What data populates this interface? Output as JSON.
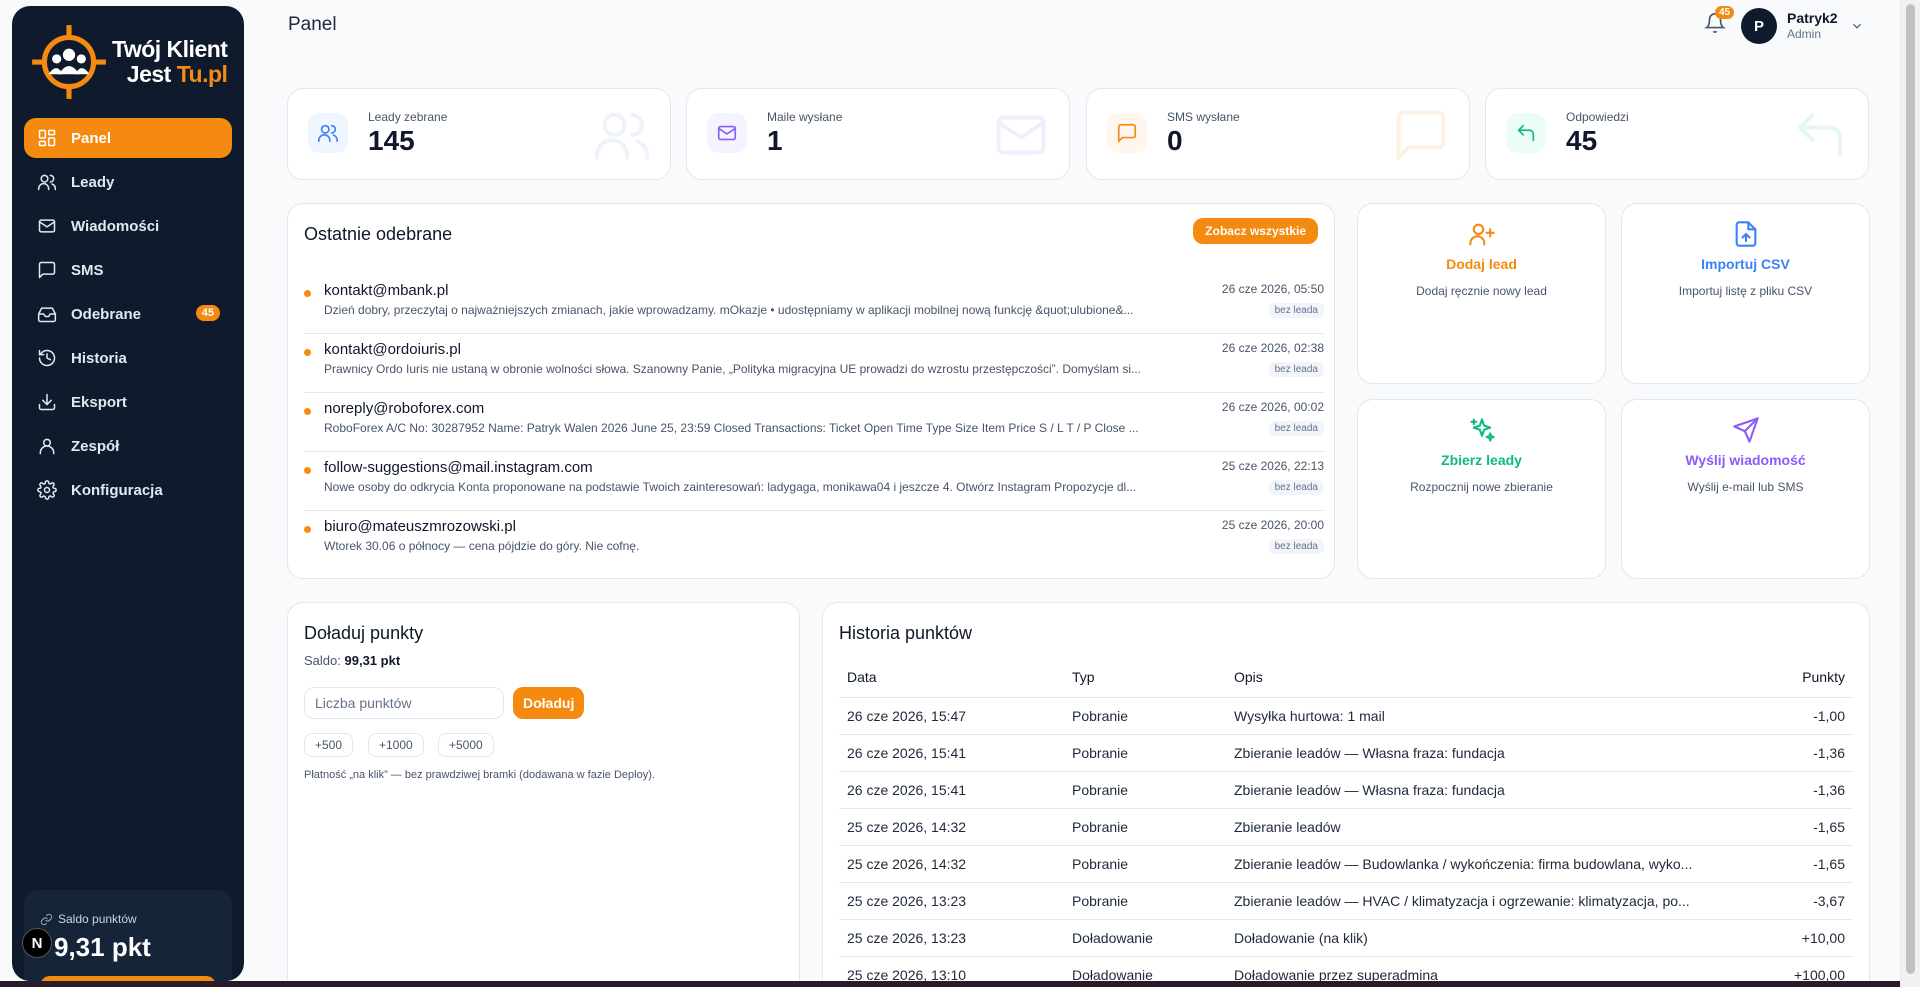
{
  "brand": {
    "line1": "Twój Klient",
    "line2a": "Jest ",
    "line2b": "Tu.pl"
  },
  "sidebar": {
    "items": [
      {
        "label": "Panel",
        "icon": "dashboard-icon",
        "active": true
      },
      {
        "label": "Leady",
        "icon": "users-icon"
      },
      {
        "label": "Wiadomości",
        "icon": "mail-icon"
      },
      {
        "label": "SMS",
        "icon": "message-square-icon"
      },
      {
        "label": "Odebrane",
        "icon": "inbox-icon",
        "badge": "45"
      },
      {
        "label": "Historia",
        "icon": "history-icon"
      },
      {
        "label": "Eksport",
        "icon": "download-icon"
      },
      {
        "label": "Zespół",
        "icon": "user-icon"
      },
      {
        "label": "Konfiguracja",
        "icon": "gear-icon"
      }
    ],
    "balance": {
      "label": "Saldo punktów",
      "value": "9,31 pkt"
    }
  },
  "header": {
    "title": "Panel",
    "notifications": "45",
    "user": {
      "initial": "P",
      "name": "Patryk2",
      "role": "Admin"
    }
  },
  "stats": [
    {
      "label": "Leady zebrane",
      "value": "145",
      "icon": "users-icon",
      "color": "#3b82f6"
    },
    {
      "label": "Maile wysłane",
      "value": "1",
      "icon": "mail-icon",
      "color": "#8b5cf6"
    },
    {
      "label": "SMS wysłane",
      "value": "0",
      "icon": "message-square-icon",
      "color": "#f58a10"
    },
    {
      "label": "Odpowiedzi",
      "value": "45",
      "icon": "reply-icon",
      "color": "#10b981"
    }
  ],
  "recent": {
    "title": "Ostatnie odebrane",
    "see_all": "Zobacz wszystkie",
    "items": [
      {
        "from": "kontakt@mbank.pl",
        "preview": "Dzień dobry, przeczytaj o najważniejszych zmianach, jakie wprowadzamy. mOkazje • udostępniamy w aplikacji mobilnej nową funkcję &quot;ulubione&...",
        "date": "26 cze 2026, 05:50",
        "tag": "bez leada"
      },
      {
        "from": "kontakt@ordoiuris.pl",
        "preview": "Prawnicy Ordo Iuris nie ustaną w obronie wolności słowa. Szanowny Panie, „Polityka migracyjna UE prowadzi do wzrostu przestępczości”. Domyślam si...",
        "date": "26 cze 2026, 02:38",
        "tag": "bez leada"
      },
      {
        "from": "noreply@roboforex.com",
        "preview": "RoboForex A/C No: 30287952 Name: Patryk Walen 2026 June 25, 23:59 Closed Transactions: Ticket Open Time Type Size Item Price S / L T / P Close ...",
        "date": "26 cze 2026, 00:02",
        "tag": "bez leada"
      },
      {
        "from": "follow-suggestions@mail.instagram.com",
        "preview": "Nowe osoby do odkrycia Konta proponowane na podstawie Twoich zainteresowań: ladygaga, monikawa04 i jeszcze 4. Otwórz Instagram Propozycje dl...",
        "date": "25 cze 2026, 22:13",
        "tag": "bez leada"
      },
      {
        "from": "biuro@mateuszmrozowski.pl",
        "preview": "Wtorek 30.06 o północy — cena pójdzie do góry. Nie cofnę.",
        "date": "25 cze 2026, 20:00",
        "tag": "bez leada"
      }
    ]
  },
  "actions": [
    {
      "title": "Dodaj lead",
      "desc": "Dodaj ręcznie nowy lead",
      "icon": "user-plus-icon",
      "color": "#f58a10"
    },
    {
      "title": "Importuj CSV",
      "desc": "Importuj listę z pliku CSV",
      "icon": "file-upload-icon",
      "color": "#3b82f6"
    },
    {
      "title": "Zbierz leady",
      "desc": "Rozpocznij nowe zbieranie",
      "icon": "sparkles-icon",
      "color": "#10b981"
    },
    {
      "title": "Wyślij wiadomość",
      "desc": "Wyślij e-mail lub SMS",
      "icon": "send-icon",
      "color": "#8b5cf6"
    }
  ],
  "topup": {
    "title": "Doładuj punkty",
    "saldo_label": "Saldo:",
    "saldo_value": "99,31 pkt",
    "placeholder": "Liczba punktów",
    "button": "Doładuj",
    "chips": [
      "+500",
      "+1000",
      "+5000"
    ],
    "note": "Płatność „na klik” — bez prawdziwej bramki (dodawana w fazie Deploy)."
  },
  "history": {
    "title": "Historia punktów",
    "columns": [
      "Data",
      "Typ",
      "Opis",
      "Punkty"
    ],
    "rows": [
      {
        "date": "26 cze 2026, 15:47",
        "type": "Pobranie",
        "desc": "Wysyłka hurtowa: 1 mail",
        "points": "-1,00"
      },
      {
        "date": "26 cze 2026, 15:41",
        "type": "Pobranie",
        "desc": "Zbieranie leadów — Własna fraza: fundacja",
        "points": "-1,36"
      },
      {
        "date": "26 cze 2026, 15:41",
        "type": "Pobranie",
        "desc": "Zbieranie leadów — Własna fraza: fundacja",
        "points": "-1,36"
      },
      {
        "date": "25 cze 2026, 14:32",
        "type": "Pobranie",
        "desc": "Zbieranie leadów",
        "points": "-1,65"
      },
      {
        "date": "25 cze 2026, 14:32",
        "type": "Pobranie",
        "desc": "Zbieranie leadów — Budowlanka / wykończenia: firma budowlana, wyko...",
        "points": "-1,65"
      },
      {
        "date": "25 cze 2026, 13:23",
        "type": "Pobranie",
        "desc": "Zbieranie leadów — HVAC / klimatyzacja i ogrzewanie: klimatyzacja, po...",
        "points": "-3,67"
      },
      {
        "date": "25 cze 2026, 13:23",
        "type": "Doładowanie",
        "desc": "Doładowanie (na klik)",
        "points": "+10,00"
      },
      {
        "date": "25 cze 2026, 13:10",
        "type": "Doładowanie",
        "desc": "Doładowanie przez superadmina",
        "points": "+100,00"
      }
    ]
  }
}
